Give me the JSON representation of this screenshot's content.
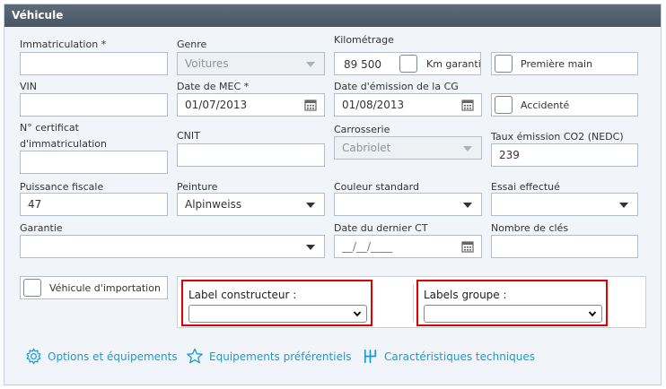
{
  "panel": {
    "title": "Véhicule"
  },
  "fields": {
    "immatriculation": {
      "label": "Immatriculation *",
      "value": ""
    },
    "genre": {
      "label": "Genre",
      "value": "Voitures"
    },
    "kilometrage": {
      "label": "Kilométrage",
      "value": "89 500",
      "checkbox_label": "Km garanti"
    },
    "premiere_main": {
      "label": "Première main"
    },
    "vin": {
      "label": "VIN",
      "value": ""
    },
    "date_mec": {
      "label": "Date de MEC *",
      "value": "01/07/2013"
    },
    "date_emission_cg": {
      "label": "Date d'émission de la CG",
      "value": "01/08/2013"
    },
    "accidente": {
      "label": "Accidenté"
    },
    "certificat": {
      "label_line1": "N° certificat",
      "label_line2": "d'immatriculation",
      "value": ""
    },
    "cnit": {
      "label": "CNIT",
      "value": ""
    },
    "carrosserie": {
      "label": "Carrosserie",
      "value": "Cabriolet"
    },
    "taux_co2": {
      "label": "Taux émission CO2 (NEDC)",
      "value": "239"
    },
    "puissance_fiscale": {
      "label": "Puissance fiscale",
      "value": "47"
    },
    "peinture": {
      "label": "Peinture",
      "value": "Alpinweiss"
    },
    "couleur_standard": {
      "label": "Couleur standard",
      "value": ""
    },
    "essai_effectue": {
      "label": "Essai effectué",
      "value": ""
    },
    "garantie": {
      "label": "Garantie",
      "value": ""
    },
    "date_dernier_ct": {
      "label": "Date du dernier CT",
      "value": "__/__/____"
    },
    "nombre_cles": {
      "label": "Nombre de clés",
      "value": ""
    },
    "vehicule_importation": {
      "label": "Véhicule d'importation"
    }
  },
  "labels": {
    "constructeur": {
      "label": "Label constructeur :",
      "value": ""
    },
    "groupe": {
      "label": "Labels groupe :",
      "value": ""
    }
  },
  "links": {
    "options": "Options et équipements",
    "preferentiels": "Equipements préférentiels",
    "techniques": "Caractéristiques techniques"
  },
  "colors": {
    "accent": "#1b9bd1",
    "highlight": "#e30000",
    "header": "#525d6a"
  },
  "icons": {
    "options": "gear-icon",
    "preferentiels": "star-icon",
    "techniques": "gearshift-icon",
    "calendar": "calendar-icon",
    "dropdown": "caret-down-icon"
  }
}
